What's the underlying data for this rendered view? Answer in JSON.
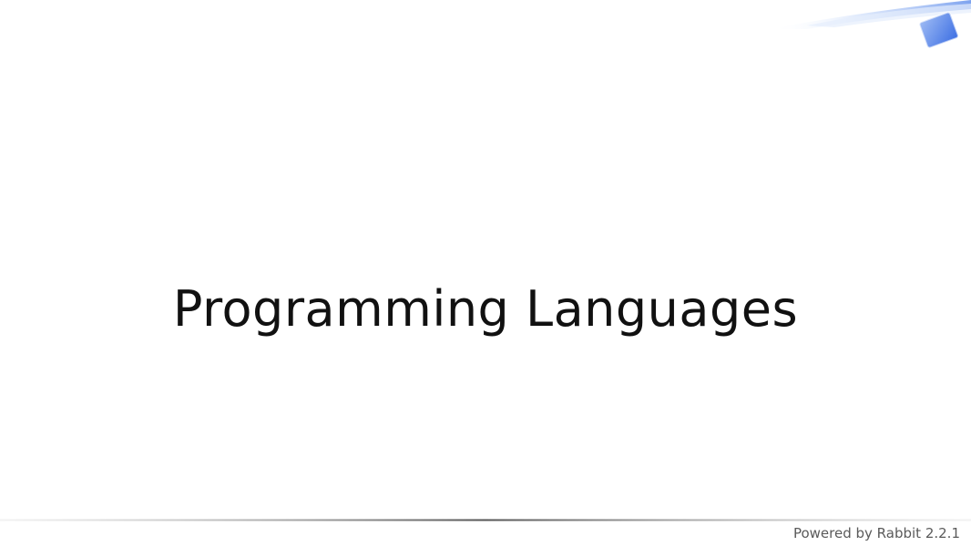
{
  "slide": {
    "title": "Programming Languages",
    "footer": "Powered by Rabbit 2.2.1"
  },
  "colors": {
    "background": "#ffffff",
    "title_text": "#111111",
    "footer_text": "#5a5a5a",
    "accent_blue": "#4f7de8"
  },
  "icons": {
    "corner": "rabbit-theme-corner-swoosh-icon"
  }
}
